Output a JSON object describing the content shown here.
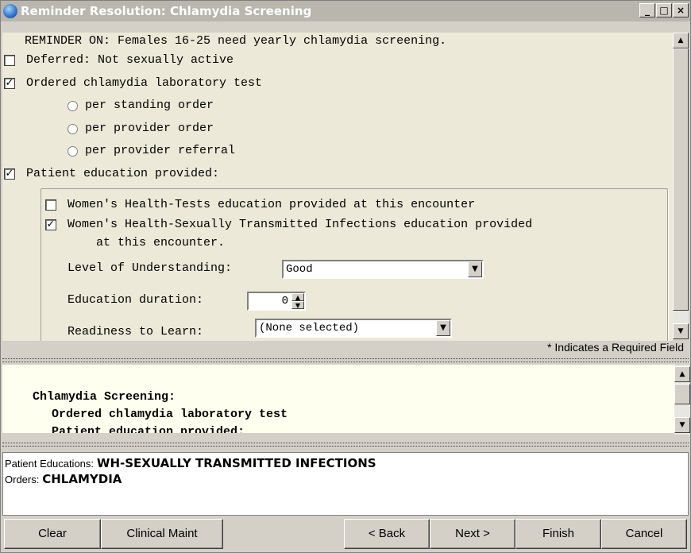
{
  "window": {
    "title": "Reminder Resolution: Chlamydia Screening",
    "minimize": "_",
    "maximize": "□",
    "close": "×"
  },
  "reminder": {
    "header": "REMINDER ON: Females 16-25 need yearly chlamydia screening.",
    "deferred_label": "Deferred: Not sexually active",
    "deferred_checked": false,
    "ordered_label": "Ordered chlamydia laboratory test",
    "ordered_checked": true,
    "radio_options": [
      "per standing order",
      "per provider order",
      "per provider referral"
    ],
    "education_label": "Patient education provided:",
    "education_checked": true
  },
  "education": {
    "womens_tests_label": "Women's Health-Tests education provided at this encounter",
    "womens_tests_checked": false,
    "womens_sti_label_line1": "Women's Health-Sexually Transmitted Infections education provided",
    "womens_sti_label_line2": "at this encounter.",
    "womens_sti_checked": true,
    "level_label": "Level of Understanding:",
    "level_value": "Good",
    "duration_label": "Education duration:",
    "duration_value": "0",
    "readiness_label": "Readiness to Learn:",
    "readiness_value": "(None selected)"
  },
  "required_note": "* Indicates a Required Field",
  "preview": {
    "line1": "Chlamydia Screening:",
    "line2": "Ordered chlamydia laboratory test",
    "line3": "Patient education provided:"
  },
  "summary": {
    "educations_key": "Patient Educations:",
    "educations_value": "WH-SEXUALLY TRANSMITTED INFECTIONS",
    "orders_key": "Orders:",
    "orders_value": "CHLAMYDIA"
  },
  "buttons": {
    "clear": "Clear",
    "clinical_maint": "Clinical Maint",
    "back": "< Back",
    "next": "Next >",
    "finish": "Finish",
    "cancel": "Cancel"
  },
  "icons": {
    "check": "✓",
    "arrow_up": "▲",
    "arrow_down": "▼"
  }
}
